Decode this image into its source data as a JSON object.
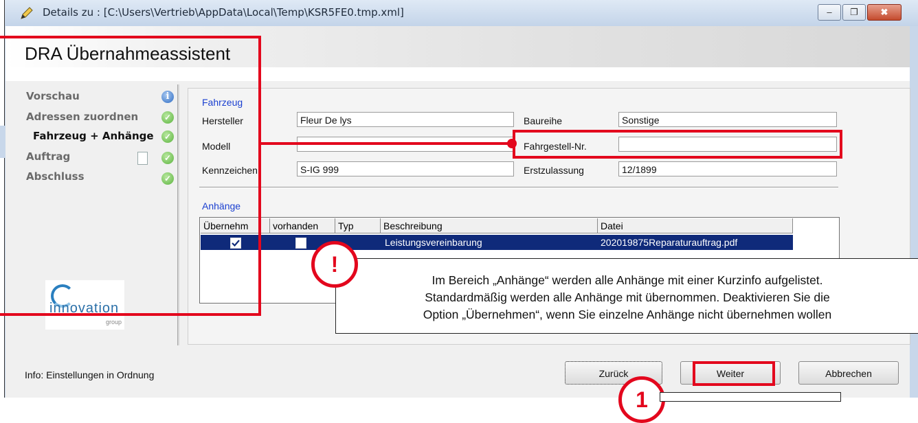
{
  "window": {
    "title": "Details zu : [C:\\Users\\Vertrieb\\AppData\\Local\\Temp\\KSR5FE0.tmp.xml]",
    "controls": {
      "minimize": "–",
      "restore": "❐",
      "close": "✖"
    }
  },
  "header": {
    "title": "DRA Übernahmeassistent"
  },
  "sidebar": {
    "steps": [
      {
        "label": "Vorschau",
        "icon": "info-icon"
      },
      {
        "label": "Adressen zuordnen",
        "icon": "check-icon"
      },
      {
        "label": "Fahrzeug + Anhänge",
        "icon": "check-icon",
        "active": true
      },
      {
        "label": "Auftrag",
        "icon": "check-icon"
      },
      {
        "label": "Abschluss",
        "icon": "check-icon"
      }
    ],
    "logo": {
      "text": "innovation",
      "sub": "group"
    }
  },
  "vehicle": {
    "section_label": "Fahrzeug",
    "hersteller_label": "Hersteller",
    "hersteller_value": "Fleur De lys",
    "modell_label": "Modell",
    "modell_value": "",
    "kennzeichen_label": "Kennzeichen",
    "kennzeichen_value": "S-IG 999",
    "baureihe_label": "Baureihe",
    "baureihe_value": "Sonstige",
    "fahrgestell_label": "Fahrgestell-Nr.",
    "fahrgestell_value": "",
    "erstzulassung_label": "Erstzulassung",
    "erstzulassung_value": "12/1899"
  },
  "attachments": {
    "section_label": "Anhänge",
    "columns": [
      "Übernehm",
      "vorhanden",
      "Typ",
      "Beschreibung",
      "Datei"
    ],
    "rows": [
      {
        "uebernehmen": true,
        "vorhanden": false,
        "typ": "",
        "beschreibung": "Leistungsvereinbarung",
        "datei": "202019875Reparaturauftrag.pdf"
      }
    ]
  },
  "status": {
    "text": "Info: Einstellungen in Ordnung"
  },
  "buttons": {
    "back": "Zurück",
    "next": "Weiter",
    "cancel": "Abbrechen"
  },
  "annotation": {
    "exclamation": "!",
    "callout_lines": [
      "Im Bereich „Anhänge“ werden alle Anhänge mit einer Kurzinfo aufgelistet.",
      "Standardmäßig werden alle Anhänge mit übernommen. Deaktivieren Sie die",
      "Option „Übernehmen“, wenn  Sie einzelne Anhänge nicht übernehmen wollen"
    ],
    "step_number": "1"
  },
  "colors": {
    "highlight": "#e3071d",
    "selection": "#0f2a7a",
    "section_label": "#1a3fd0"
  }
}
